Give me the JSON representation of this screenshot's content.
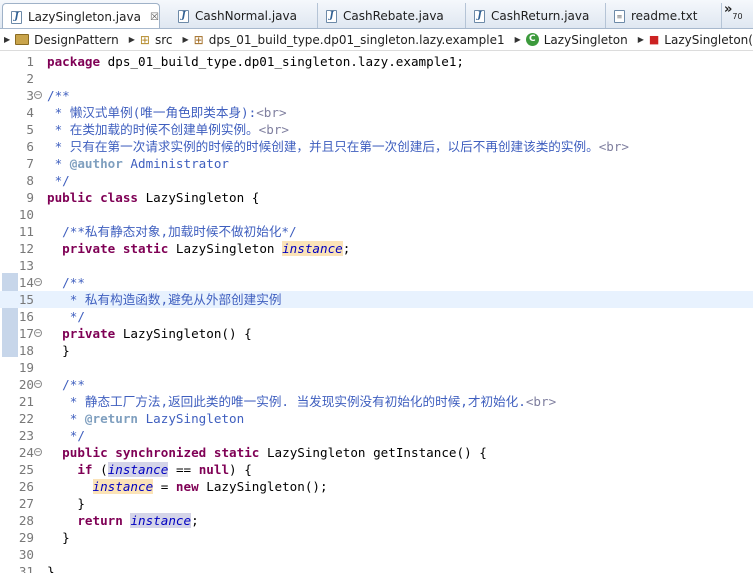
{
  "tabs": [
    {
      "label": "LazySingleton.java",
      "icon": "java-file-icon",
      "active": true,
      "closable": true
    },
    {
      "label": "CashNormal.java",
      "icon": "java-file-icon"
    },
    {
      "label": "CashRebate.java",
      "icon": "java-file-icon"
    },
    {
      "label": "CashReturn.java",
      "icon": "java-file-icon"
    },
    {
      "label": "readme.txt",
      "icon": "text-file-icon"
    }
  ],
  "tab_close_glyph": "☒",
  "tab_overflow": {
    "glyph": "»",
    "count": "70"
  },
  "breadcrumb": [
    {
      "label": "DesignPattern",
      "icon": "project-icon"
    },
    {
      "label": "src",
      "icon": "source-folder-icon"
    },
    {
      "label": "dps_01_build_type.dp01_singleton.lazy.example1",
      "icon": "package-icon"
    },
    {
      "label": "LazySingleton",
      "icon": "class-icon"
    },
    {
      "label": "LazySingleton()",
      "icon": "constructor-icon"
    }
  ],
  "editor": {
    "current_line": 15,
    "lines": [
      {
        "n": "1",
        "segs": [
          [
            "kw",
            "package"
          ],
          [
            "txt",
            " dps_01_build_type.dp01_singleton.lazy.example1;"
          ]
        ]
      },
      {
        "n": "2",
        "segs": []
      },
      {
        "n": "3",
        "fold": "−",
        "segs": [
          [
            "cm",
            "/**"
          ]
        ]
      },
      {
        "n": "4",
        "segs": [
          [
            "cm",
            " * 懒汉式单例(唯一角色即类本身):"
          ],
          [
            "tag",
            "<br>"
          ]
        ]
      },
      {
        "n": "5",
        "segs": [
          [
            "cm",
            " * 在类加载的时候不创建单例实例。"
          ],
          [
            "tag",
            "<br>"
          ]
        ]
      },
      {
        "n": "6",
        "segs": [
          [
            "cm",
            " * 只有在第一次请求实例的时候的时候创建，并且只在第一次创建后，以后不再创建该类的实例。"
          ],
          [
            "tag",
            "<br>"
          ]
        ]
      },
      {
        "n": "7",
        "segs": [
          [
            "cm",
            " * "
          ],
          [
            "at",
            "@author"
          ],
          [
            "cm",
            " Administrator"
          ]
        ]
      },
      {
        "n": "8",
        "segs": [
          [
            "cm",
            " */"
          ]
        ]
      },
      {
        "n": "9",
        "segs": [
          [
            "kw",
            "public"
          ],
          [
            "txt",
            " "
          ],
          [
            "kw",
            "class"
          ],
          [
            "txt",
            " LazySingleton {"
          ]
        ]
      },
      {
        "n": "10",
        "segs": []
      },
      {
        "n": "11",
        "segs": [
          [
            "txt",
            "  "
          ],
          [
            "cm",
            "/**私有静态对象,加载时候不做初始化*/"
          ]
        ]
      },
      {
        "n": "12",
        "segs": [
          [
            "txt",
            "  "
          ],
          [
            "kw",
            "private"
          ],
          [
            "txt",
            " "
          ],
          [
            "kw",
            "static"
          ],
          [
            "txt",
            " LazySingleton "
          ],
          [
            "field hl-def",
            "instance"
          ],
          [
            "txt",
            ";"
          ]
        ]
      },
      {
        "n": "13",
        "segs": []
      },
      {
        "n": "14",
        "fold": "−",
        "segs": [
          [
            "txt",
            "  "
          ],
          [
            "cm",
            "/**"
          ]
        ]
      },
      {
        "n": "15",
        "segs": [
          [
            "txt",
            "  "
          ],
          [
            "cm",
            " * 私有构造函数,避免从外部创建实例"
          ]
        ]
      },
      {
        "n": "16",
        "segs": [
          [
            "txt",
            "  "
          ],
          [
            "cm",
            " */"
          ]
        ]
      },
      {
        "n": "17",
        "fold": "−",
        "segs": [
          [
            "txt",
            "  "
          ],
          [
            "kw",
            "private"
          ],
          [
            "txt",
            " LazySingleton() {"
          ]
        ]
      },
      {
        "n": "18",
        "segs": [
          [
            "txt",
            "  }"
          ]
        ]
      },
      {
        "n": "19",
        "segs": []
      },
      {
        "n": "20",
        "fold": "−",
        "segs": [
          [
            "txt",
            "  "
          ],
          [
            "cm",
            "/**"
          ]
        ]
      },
      {
        "n": "21",
        "segs": [
          [
            "txt",
            "  "
          ],
          [
            "cm",
            " * 静态工厂方法,返回此类的唯一实例. 当发现实例没有初始化的时候,才初始化."
          ],
          [
            "tag",
            "<br>"
          ]
        ]
      },
      {
        "n": "22",
        "segs": [
          [
            "txt",
            "  "
          ],
          [
            "cm",
            " * "
          ],
          [
            "at",
            "@return"
          ],
          [
            "cm",
            " LazySingleton"
          ]
        ]
      },
      {
        "n": "23",
        "segs": [
          [
            "txt",
            "  "
          ],
          [
            "cm",
            " */"
          ]
        ]
      },
      {
        "n": "24",
        "fold": "−",
        "segs": [
          [
            "txt",
            "  "
          ],
          [
            "kw",
            "public"
          ],
          [
            "txt",
            " "
          ],
          [
            "kw",
            "synchronized"
          ],
          [
            "txt",
            " "
          ],
          [
            "kw",
            "static"
          ],
          [
            "txt",
            " LazySingleton getInstance() {"
          ]
        ]
      },
      {
        "n": "25",
        "segs": [
          [
            "txt",
            "    "
          ],
          [
            "kw",
            "if"
          ],
          [
            "txt",
            " ("
          ],
          [
            "field hl-use",
            "instance"
          ],
          [
            "txt",
            " == "
          ],
          [
            "kw",
            "null"
          ],
          [
            "txt",
            ") {"
          ]
        ]
      },
      {
        "n": "26",
        "segs": [
          [
            "txt",
            "      "
          ],
          [
            "field hl-def",
            "instance"
          ],
          [
            "txt",
            " = "
          ],
          [
            "kw",
            "new"
          ],
          [
            "txt",
            " LazySingleton();"
          ]
        ]
      },
      {
        "n": "27",
        "segs": [
          [
            "txt",
            "    }"
          ]
        ]
      },
      {
        "n": "28",
        "segs": [
          [
            "txt",
            "    "
          ],
          [
            "kw",
            "return"
          ],
          [
            "txt",
            " "
          ],
          [
            "field hl-use",
            "instance"
          ],
          [
            "txt",
            ";"
          ]
        ]
      },
      {
        "n": "29",
        "segs": [
          [
            "txt",
            "  }"
          ]
        ]
      },
      {
        "n": "30",
        "segs": []
      },
      {
        "n": "31",
        "segs": [
          [
            "txt",
            "}"
          ]
        ]
      }
    ]
  }
}
